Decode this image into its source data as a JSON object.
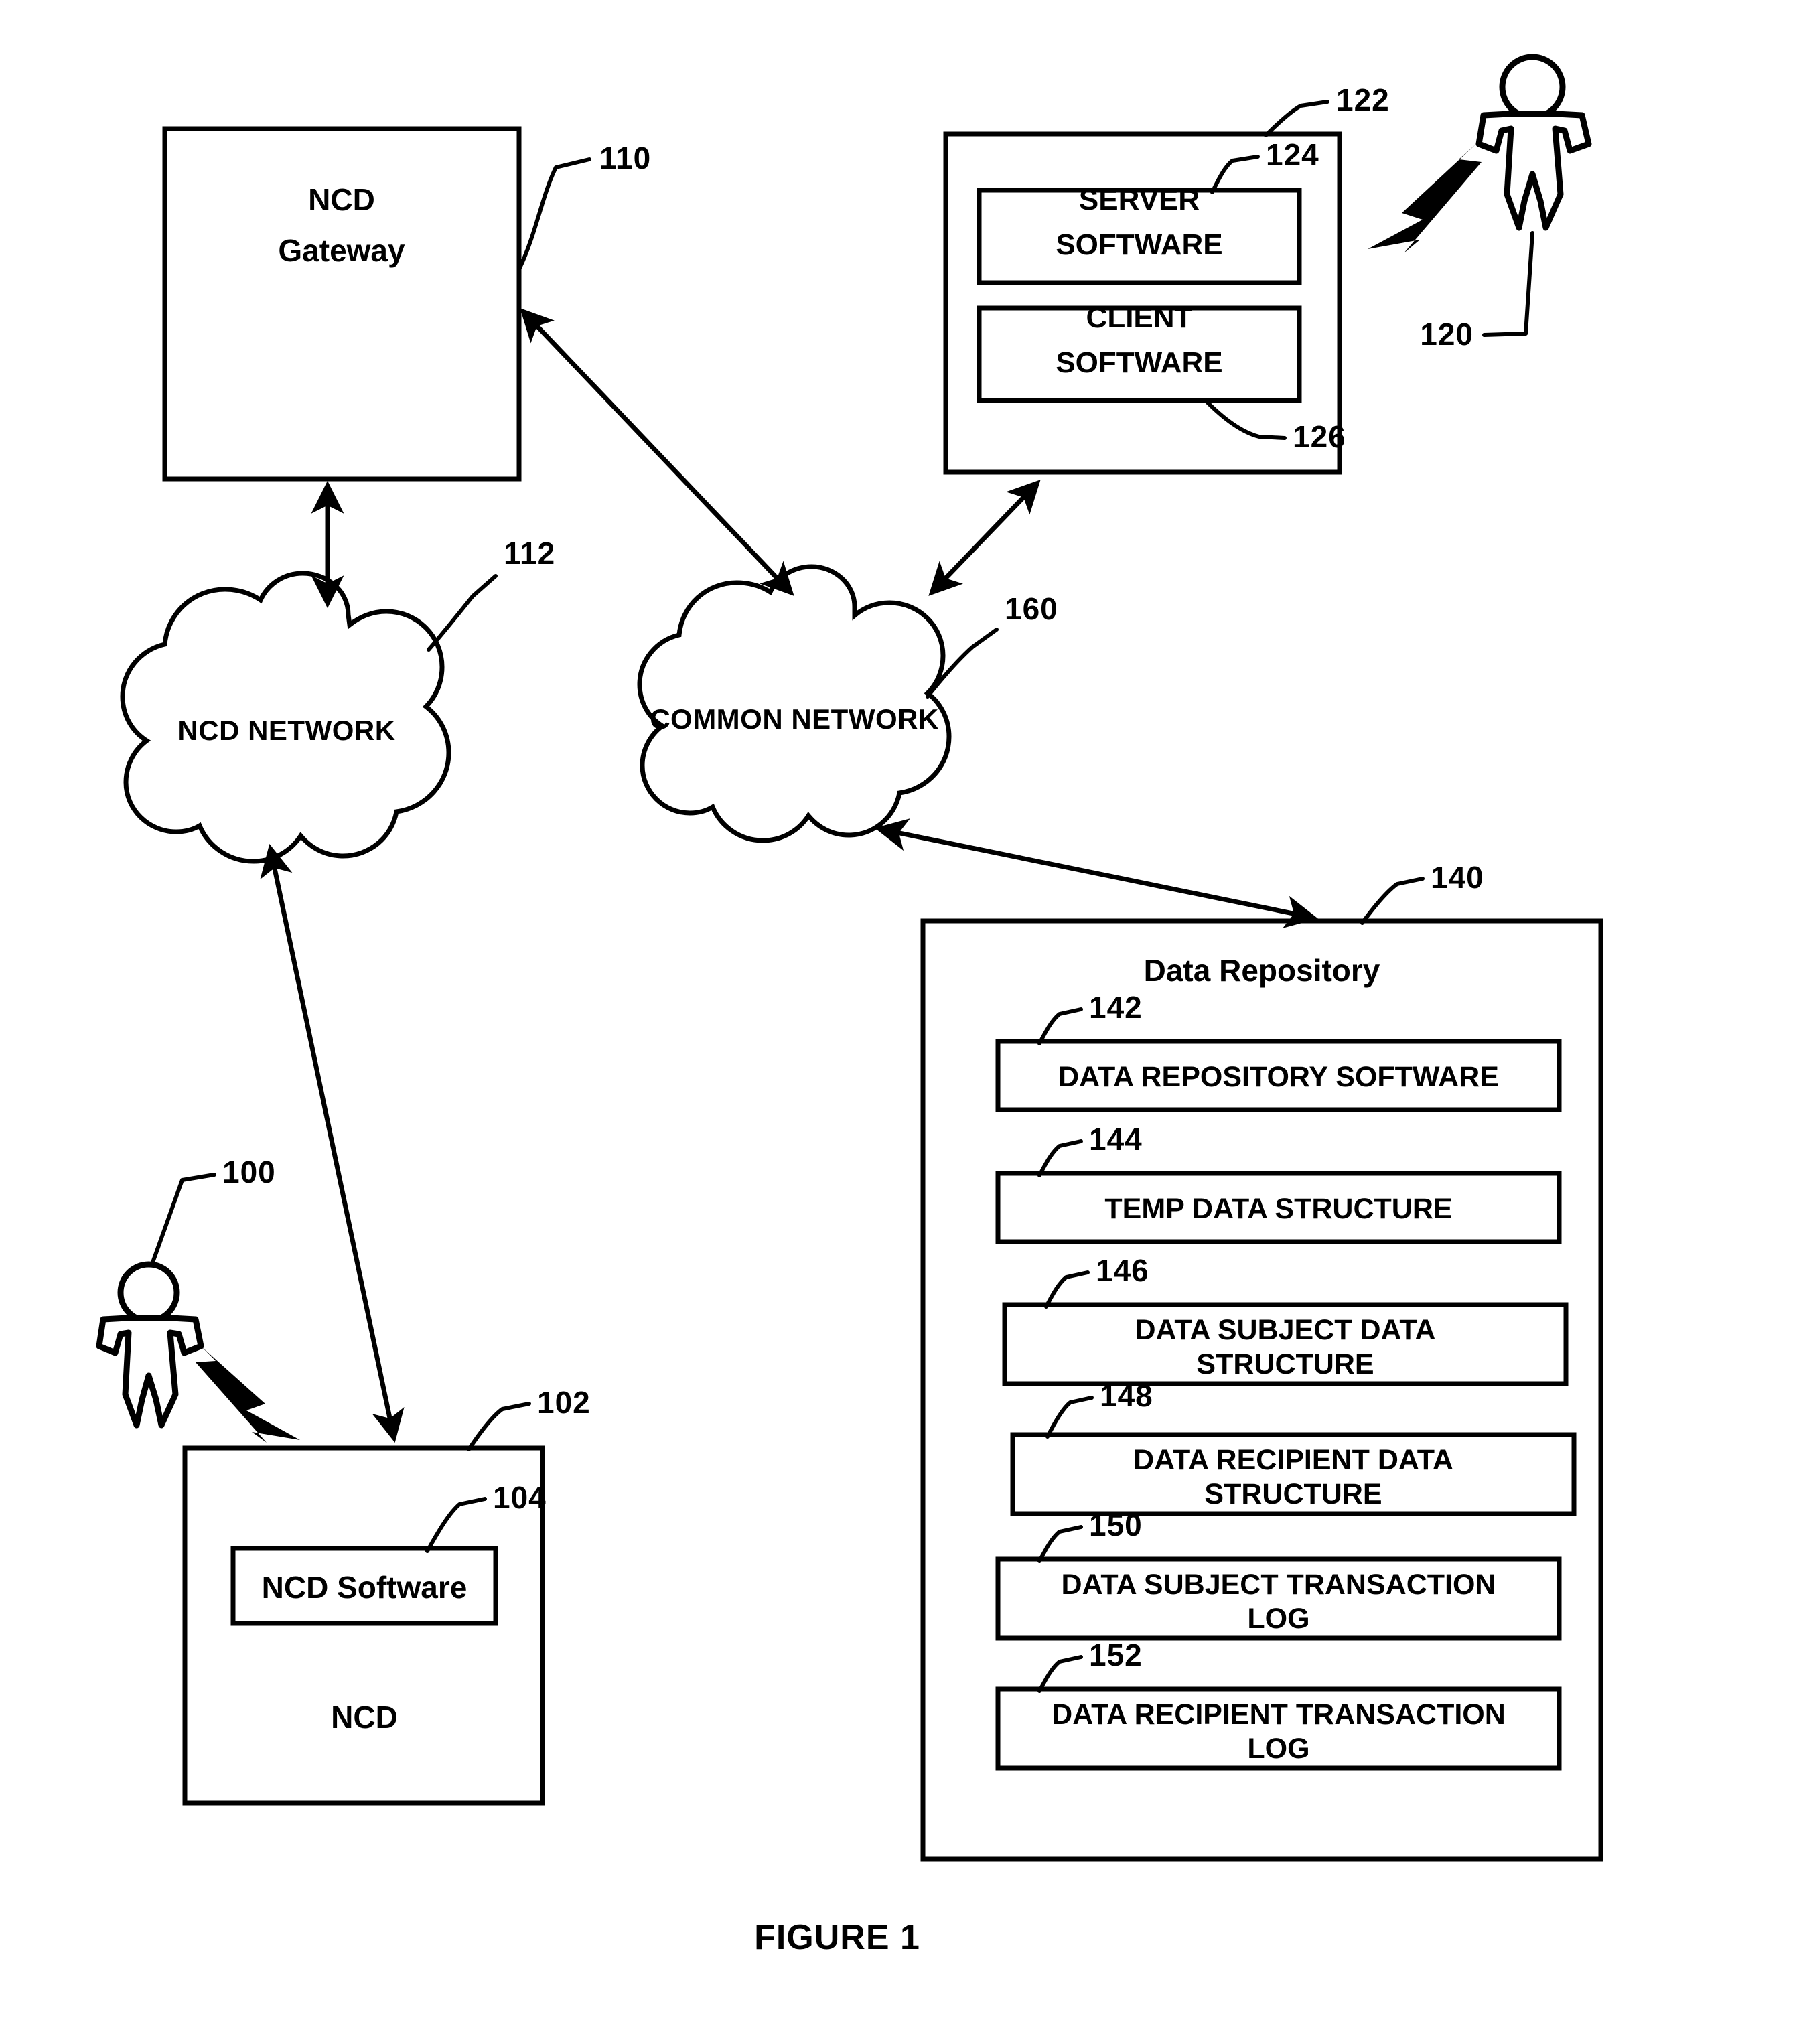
{
  "figure": {
    "caption": "FIGURE 1"
  },
  "nodes": {
    "ncd_gateway": {
      "line1": "NCD",
      "line2": "Gateway",
      "ref": "110"
    },
    "ncd_network": {
      "label": "NCD NETWORK",
      "ref": "112"
    },
    "common_network": {
      "label": "COMMON NETWORK",
      "ref": "160"
    },
    "server_host": {
      "ref": "122",
      "server_software": {
        "line1": "SERVER",
        "line2": "SOFTWARE",
        "ref": "124"
      },
      "client_software": {
        "line1": "CLIENT",
        "line2": "SOFTWARE",
        "ref": "126"
      }
    },
    "data_recipient_person": {
      "ref": "120"
    },
    "data_subject_person": {
      "ref": "100"
    },
    "ncd": {
      "label": "NCD",
      "ref": "102",
      "software": {
        "label": "NCD Software",
        "ref": "104"
      }
    },
    "data_repository": {
      "title": "Data Repository",
      "ref": "140",
      "items": [
        {
          "label": "DATA REPOSITORY SOFTWARE",
          "ref": "142",
          "lines": [
            "DATA REPOSITORY SOFTWARE"
          ]
        },
        {
          "label": "TEMP DATA STRUCTURE",
          "ref": "144",
          "lines": [
            "TEMP DATA STRUCTURE"
          ]
        },
        {
          "label": "DATA SUBJECT DATA STRUCTURE",
          "ref": "146",
          "lines": [
            "DATA SUBJECT DATA",
            "STRUCTURE"
          ]
        },
        {
          "label": "DATA RECIPIENT DATA STRUCTURE",
          "ref": "148",
          "lines": [
            "DATA RECIPIENT DATA",
            "STRUCTURE"
          ]
        },
        {
          "label": "DATA SUBJECT TRANSACTION LOG",
          "ref": "150",
          "lines": [
            "DATA SUBJECT TRANSACTION",
            "LOG"
          ]
        },
        {
          "label": "DATA RECIPIENT TRANSACTION LOG",
          "ref": "152",
          "lines": [
            "DATA RECIPIENT TRANSACTION",
            "LOG"
          ]
        }
      ]
    }
  },
  "colors": {
    "ink": "#000000",
    "paper": "#ffffff"
  }
}
